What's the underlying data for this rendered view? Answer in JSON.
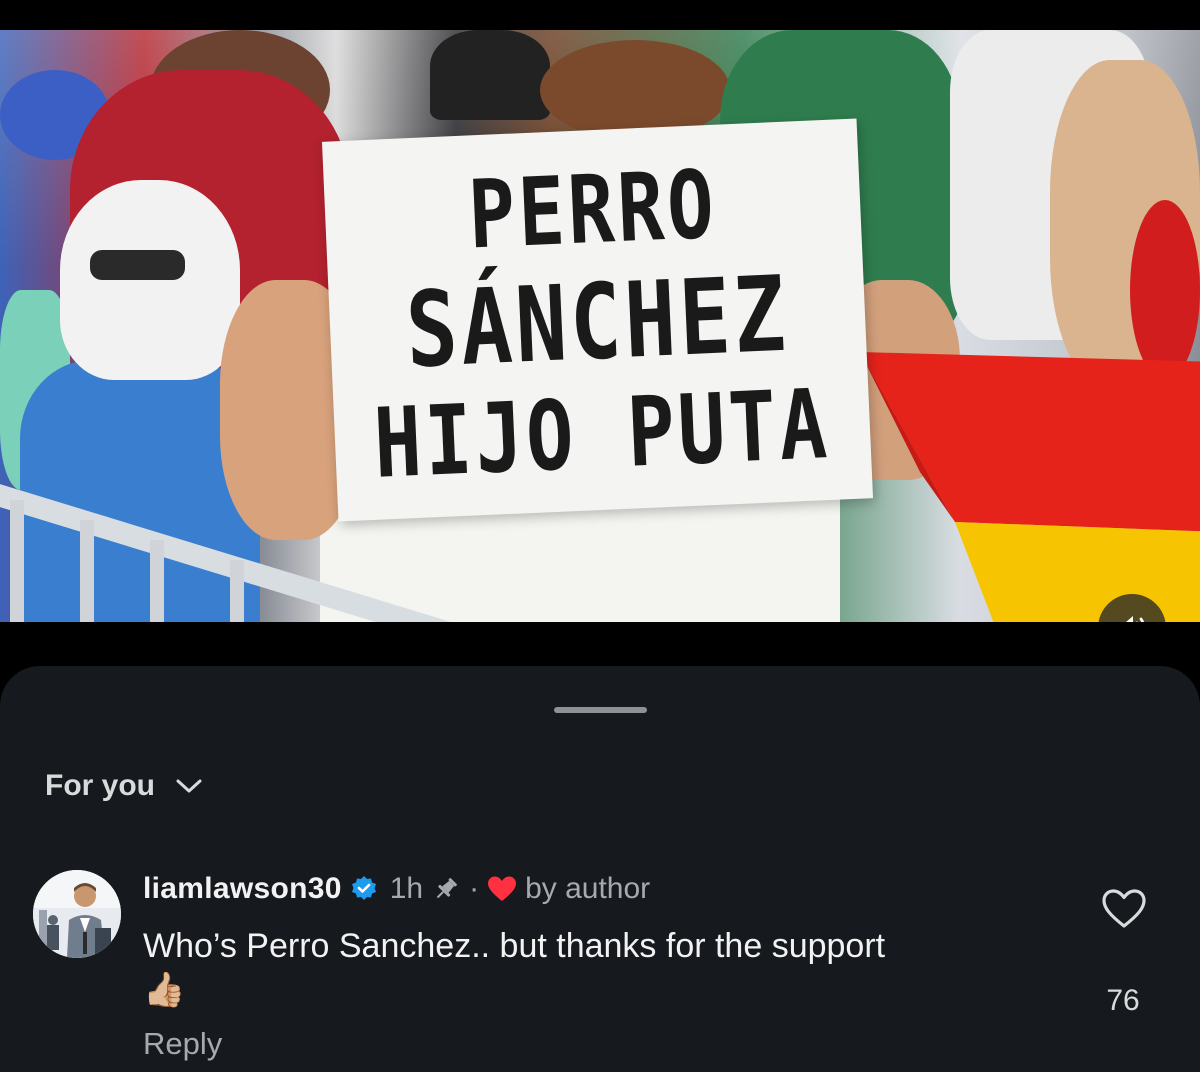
{
  "video": {
    "sign_lines": [
      "PERRO",
      "SÁNCHEZ",
      "HIJO PUTA"
    ],
    "volume_icon": "speaker-volume-icon"
  },
  "sheet": {
    "sort_label": "For you",
    "sort_icon": "chevron-down-icon"
  },
  "comment": {
    "username": "liamlawson30",
    "verified_icon": "verified-badge-icon",
    "time": "1h",
    "pin_icon": "pin-icon",
    "separator": "·",
    "heart_icon": "red-heart-icon",
    "liked_by": "by author",
    "text": "Who’s Perro Sanchez.. but thanks for the support",
    "emoji": "👍🏼",
    "reply_label": "Reply",
    "like_count": "76"
  },
  "colors": {
    "sheet_bg": "#16191d",
    "verified": "#1d9bf0",
    "heart": "#ff3040",
    "secondary_text": "#a7a9ad"
  }
}
